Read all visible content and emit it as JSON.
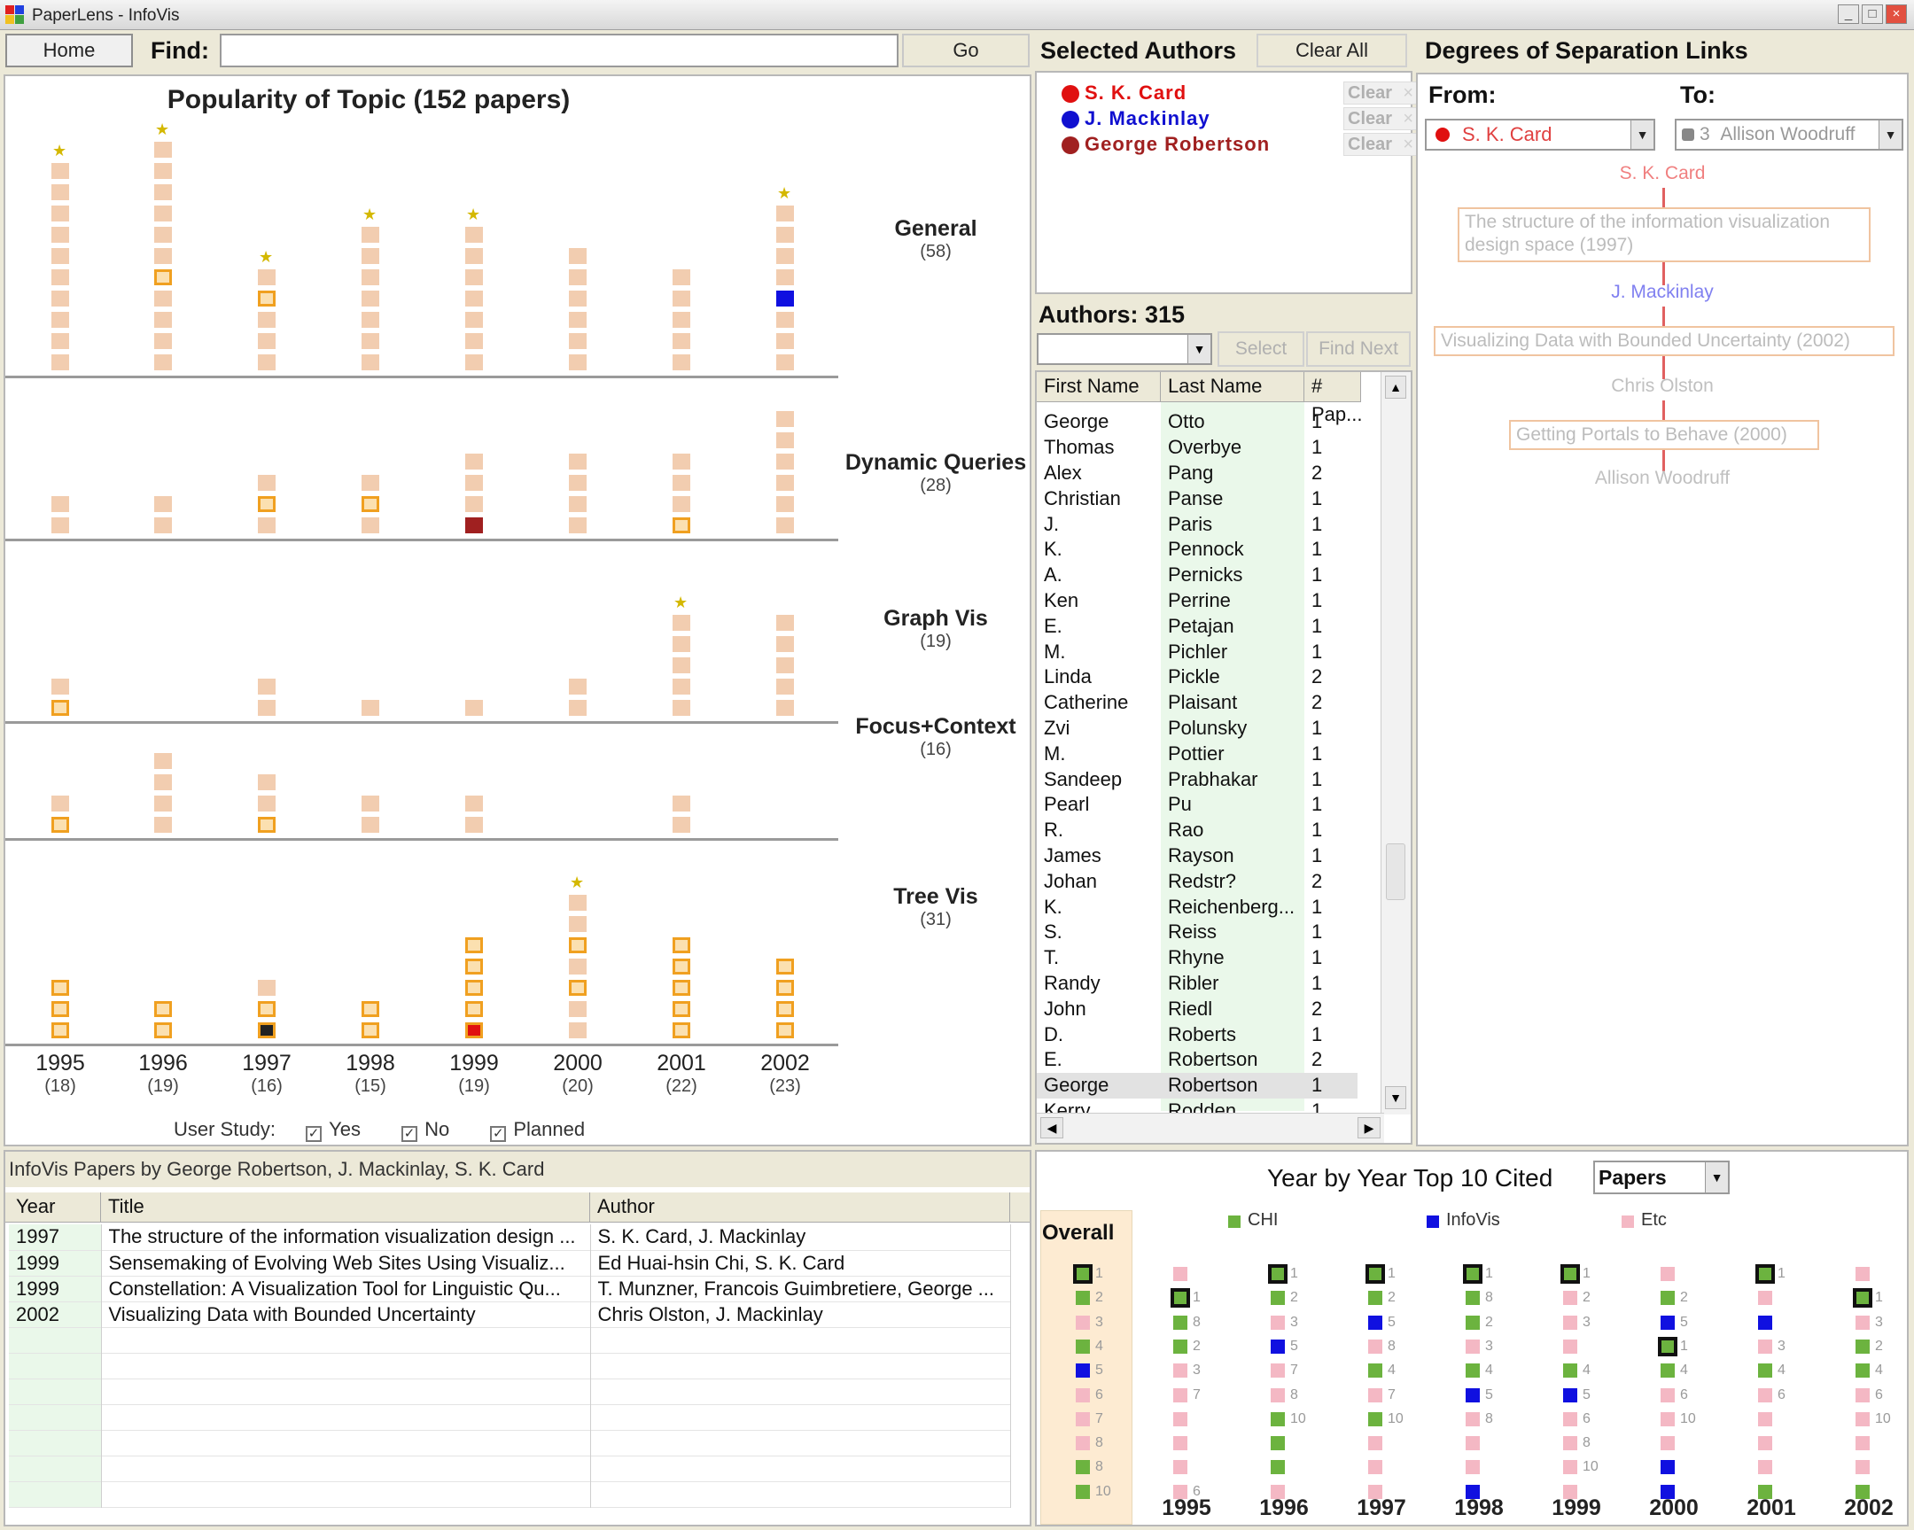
{
  "window": {
    "title": "PaperLens - InfoVis",
    "minimize": "_",
    "restore": "□",
    "close": "×"
  },
  "toolbar": {
    "home": "Home",
    "find_label": "Find:",
    "find_value": "",
    "go": "Go"
  },
  "popularity": {
    "title": "Popularity of Topic (152 papers)",
    "topics": [
      {
        "name": "General",
        "count": "(58)"
      },
      {
        "name": "Dynamic Queries",
        "count": "(28)"
      },
      {
        "name": "Graph Vis",
        "count": "(19)"
      },
      {
        "name": "Focus+Context",
        "count": "(16)"
      },
      {
        "name": "Tree Vis",
        "count": "(31)"
      }
    ],
    "years": [
      {
        "year": "1995",
        "count": "(18)"
      },
      {
        "year": "1996",
        "count": "(19)"
      },
      {
        "year": "1997",
        "count": "(16)"
      },
      {
        "year": "1998",
        "count": "(15)"
      },
      {
        "year": "1999",
        "count": "(19)"
      },
      {
        "year": "2000",
        "count": "(20)"
      },
      {
        "year": "2001",
        "count": "(22)"
      },
      {
        "year": "2002",
        "count": "(23)"
      }
    ],
    "stacks": [
      [
        10,
        11,
        5,
        7,
        7,
        6,
        5,
        8
      ],
      [
        2,
        2,
        3,
        3,
        4,
        4,
        4,
        6
      ],
      [
        2,
        0,
        2,
        1,
        1,
        2,
        5,
        5
      ],
      [
        2,
        4,
        3,
        2,
        2,
        0,
        2,
        0
      ],
      [
        3,
        2,
        3,
        2,
        5,
        7,
        5,
        4
      ]
    ],
    "user_study_label": "User Study:",
    "user_study": {
      "yes": "Yes",
      "no": "No",
      "planned": "Planned"
    }
  },
  "selected_authors": {
    "title": "Selected Authors",
    "clear_all": "Clear All",
    "clear": "Clear",
    "authors": [
      {
        "name": "S. K. Card",
        "color": "#e01010"
      },
      {
        "name": "J. Mackinlay",
        "color": "#1010d0"
      },
      {
        "name": "George Robertson",
        "color": "#a02020"
      }
    ]
  },
  "authors_list": {
    "title": "Authors: 315",
    "select": "Select",
    "find_next": "Find Next",
    "columns": [
      "First Name",
      "Last Name",
      "# Pap..."
    ],
    "rows": [
      [
        "George",
        "Otto",
        "1"
      ],
      [
        "Thomas",
        "Overbye",
        "1"
      ],
      [
        "Alex",
        "Pang",
        "2"
      ],
      [
        "Christian",
        "Panse",
        "1"
      ],
      [
        "J.",
        "Paris",
        "1"
      ],
      [
        "K.",
        "Pennock",
        "1"
      ],
      [
        "A.",
        "Pernicks",
        "1"
      ],
      [
        "Ken",
        "Perrine",
        "1"
      ],
      [
        "E.",
        "Petajan",
        "1"
      ],
      [
        "M.",
        "Pichler",
        "1"
      ],
      [
        "Linda",
        "Pickle",
        "2"
      ],
      [
        "Catherine",
        "Plaisant",
        "2"
      ],
      [
        "Zvi",
        "Polunsky",
        "1"
      ],
      [
        "M.",
        "Pottier",
        "1"
      ],
      [
        "Sandeep",
        "Prabhakar",
        "1"
      ],
      [
        "Pearl",
        "Pu",
        "1"
      ],
      [
        "R.",
        "Rao",
        "1"
      ],
      [
        "James",
        "Rayson",
        "1"
      ],
      [
        "Johan",
        "Redstr?",
        "2"
      ],
      [
        "K.",
        "Reichenberg...",
        "1"
      ],
      [
        "S.",
        "Reiss",
        "1"
      ],
      [
        "T.",
        "Rhyne",
        "1"
      ],
      [
        "Randy",
        "Ribler",
        "1"
      ],
      [
        "John",
        "Riedl",
        "2"
      ],
      [
        "D.",
        "Roberts",
        "1"
      ],
      [
        "E.",
        "Robertson",
        "2"
      ],
      [
        "George",
        "Robertson",
        "1"
      ],
      [
        "Kerry",
        "Rodden",
        "1"
      ]
    ]
  },
  "degrees": {
    "title": "Degrees of Separation Links",
    "from_label": "From:",
    "to_label": "To:",
    "from_value": "S. K. Card",
    "to_count": "3",
    "to_value": "Allison Woodruff",
    "chain": [
      {
        "type": "author",
        "text": "S. K. Card",
        "color": "#f08080"
      },
      {
        "type": "paper",
        "text": "The structure of the information visualization design space (1997)"
      },
      {
        "type": "author",
        "text": "J. Mackinlay",
        "color": "#8080f0"
      },
      {
        "type": "paper",
        "text": "Visualizing Data with Bounded Uncertainty (2002)"
      },
      {
        "type": "author",
        "text": "Chris Olston",
        "color": "#c0c0c0"
      },
      {
        "type": "paper",
        "text": "Getting Portals to Behave (2000)"
      },
      {
        "type": "author",
        "text": "Allison Woodruff",
        "color": "#c0c0c0"
      }
    ]
  },
  "papers": {
    "title": "InfoVis Papers by George Robertson, J. Mackinlay, S. K. Card",
    "columns": [
      "Year",
      "Title",
      "Author"
    ],
    "rows": [
      [
        "1997",
        "The structure of the information visualization design ...",
        "S. K. Card, J. Mackinlay"
      ],
      [
        "1999",
        "Sensemaking of Evolving Web Sites Using Visualiz...",
        "Ed Huai-hsin Chi, S. K. Card"
      ],
      [
        "1999",
        "Constellation: A Visualization Tool for Linguistic Qu...",
        "T. Munzner, Francois Guimbretiere, George ..."
      ],
      [
        "2002",
        "Visualizing Data with Bounded Uncertainty",
        "Chris Olston, J. Mackinlay"
      ]
    ]
  },
  "top10": {
    "title": "Year by Year Top 10 Cited",
    "dropdown": "Papers",
    "legend": [
      {
        "name": "CHI",
        "color": "#6cb33f"
      },
      {
        "name": "InfoVis",
        "color": "#1010e0"
      },
      {
        "name": "Etc",
        "color": "#f4b8c4"
      }
    ],
    "overall_label": "Overall",
    "overall": [
      {
        "c": "g",
        "n": "1",
        "b": true
      },
      {
        "c": "g",
        "n": "2"
      },
      {
        "c": "p",
        "n": "3"
      },
      {
        "c": "g",
        "n": "4"
      },
      {
        "c": "b",
        "n": "5"
      },
      {
        "c": "p",
        "n": "6"
      },
      {
        "c": "p",
        "n": "7"
      },
      {
        "c": "p",
        "n": "8"
      },
      {
        "c": "g",
        "n": "8"
      },
      {
        "c": "g",
        "n": "10"
      }
    ],
    "years": [
      {
        "year": "1995",
        "items": [
          {
            "c": "p",
            "n": ""
          },
          {
            "c": "g",
            "n": "1",
            "b": true
          },
          {
            "c": "g",
            "n": "8"
          },
          {
            "c": "g",
            "n": "2"
          },
          {
            "c": "p",
            "n": "3"
          },
          {
            "c": "p",
            "n": "7"
          },
          {
            "c": "p",
            "n": ""
          },
          {
            "c": "p",
            "n": ""
          },
          {
            "c": "p",
            "n": ""
          },
          {
            "c": "p",
            "n": "6"
          }
        ]
      },
      {
        "year": "1996",
        "items": [
          {
            "c": "g",
            "n": "1",
            "b": true
          },
          {
            "c": "g",
            "n": "2"
          },
          {
            "c": "p",
            "n": "3"
          },
          {
            "c": "b",
            "n": "5"
          },
          {
            "c": "p",
            "n": "7"
          },
          {
            "c": "p",
            "n": "8"
          },
          {
            "c": "g",
            "n": "10"
          },
          {
            "c": "g",
            "n": ""
          },
          {
            "c": "g",
            "n": ""
          },
          {
            "c": "p",
            "n": ""
          }
        ]
      },
      {
        "year": "1997",
        "items": [
          {
            "c": "g",
            "n": "1",
            "b": true
          },
          {
            "c": "g",
            "n": "2"
          },
          {
            "c": "b",
            "n": "5"
          },
          {
            "c": "p",
            "n": "8"
          },
          {
            "c": "g",
            "n": "4"
          },
          {
            "c": "p",
            "n": "7"
          },
          {
            "c": "g",
            "n": "10"
          },
          {
            "c": "p",
            "n": ""
          },
          {
            "c": "p",
            "n": ""
          },
          {
            "c": "p",
            "n": ""
          }
        ]
      },
      {
        "year": "1998",
        "items": [
          {
            "c": "g",
            "n": "1",
            "b": true
          },
          {
            "c": "g",
            "n": "8"
          },
          {
            "c": "g",
            "n": "2"
          },
          {
            "c": "p",
            "n": "3"
          },
          {
            "c": "g",
            "n": "4"
          },
          {
            "c": "b",
            "n": "5"
          },
          {
            "c": "p",
            "n": "8"
          },
          {
            "c": "p",
            "n": ""
          },
          {
            "c": "p",
            "n": ""
          },
          {
            "c": "b",
            "n": ""
          }
        ]
      },
      {
        "year": "1999",
        "items": [
          {
            "c": "g",
            "n": "1",
            "b": true
          },
          {
            "c": "p",
            "n": "2"
          },
          {
            "c": "p",
            "n": "3"
          },
          {
            "c": "p",
            "n": ""
          },
          {
            "c": "g",
            "n": "4"
          },
          {
            "c": "b",
            "n": "5"
          },
          {
            "c": "p",
            "n": "6"
          },
          {
            "c": "p",
            "n": "8"
          },
          {
            "c": "p",
            "n": "10"
          },
          {
            "c": "p",
            "n": ""
          }
        ]
      },
      {
        "year": "2000",
        "items": [
          {
            "c": "p",
            "n": ""
          },
          {
            "c": "g",
            "n": "2"
          },
          {
            "c": "b",
            "n": "5"
          },
          {
            "c": "g",
            "n": "1",
            "b": true
          },
          {
            "c": "g",
            "n": "4"
          },
          {
            "c": "p",
            "n": "6"
          },
          {
            "c": "p",
            "n": "10"
          },
          {
            "c": "p",
            "n": ""
          },
          {
            "c": "b",
            "n": ""
          },
          {
            "c": "b",
            "n": ""
          }
        ]
      },
      {
        "year": "2001",
        "items": [
          {
            "c": "g",
            "n": "1",
            "b": true
          },
          {
            "c": "p",
            "n": ""
          },
          {
            "c": "b",
            "n": ""
          },
          {
            "c": "p",
            "n": "3"
          },
          {
            "c": "g",
            "n": "4"
          },
          {
            "c": "p",
            "n": "6"
          },
          {
            "c": "p",
            "n": ""
          },
          {
            "c": "p",
            "n": ""
          },
          {
            "c": "p",
            "n": ""
          },
          {
            "c": "g",
            "n": ""
          }
        ]
      },
      {
        "year": "2002",
        "items": [
          {
            "c": "p",
            "n": ""
          },
          {
            "c": "g",
            "n": "1",
            "b": true
          },
          {
            "c": "p",
            "n": "3"
          },
          {
            "c": "g",
            "n": "2"
          },
          {
            "c": "g",
            "n": "4"
          },
          {
            "c": "p",
            "n": "6"
          },
          {
            "c": "p",
            "n": "10"
          },
          {
            "c": "p",
            "n": ""
          },
          {
            "c": "p",
            "n": ""
          },
          {
            "c": "g",
            "n": ""
          }
        ]
      }
    ]
  }
}
